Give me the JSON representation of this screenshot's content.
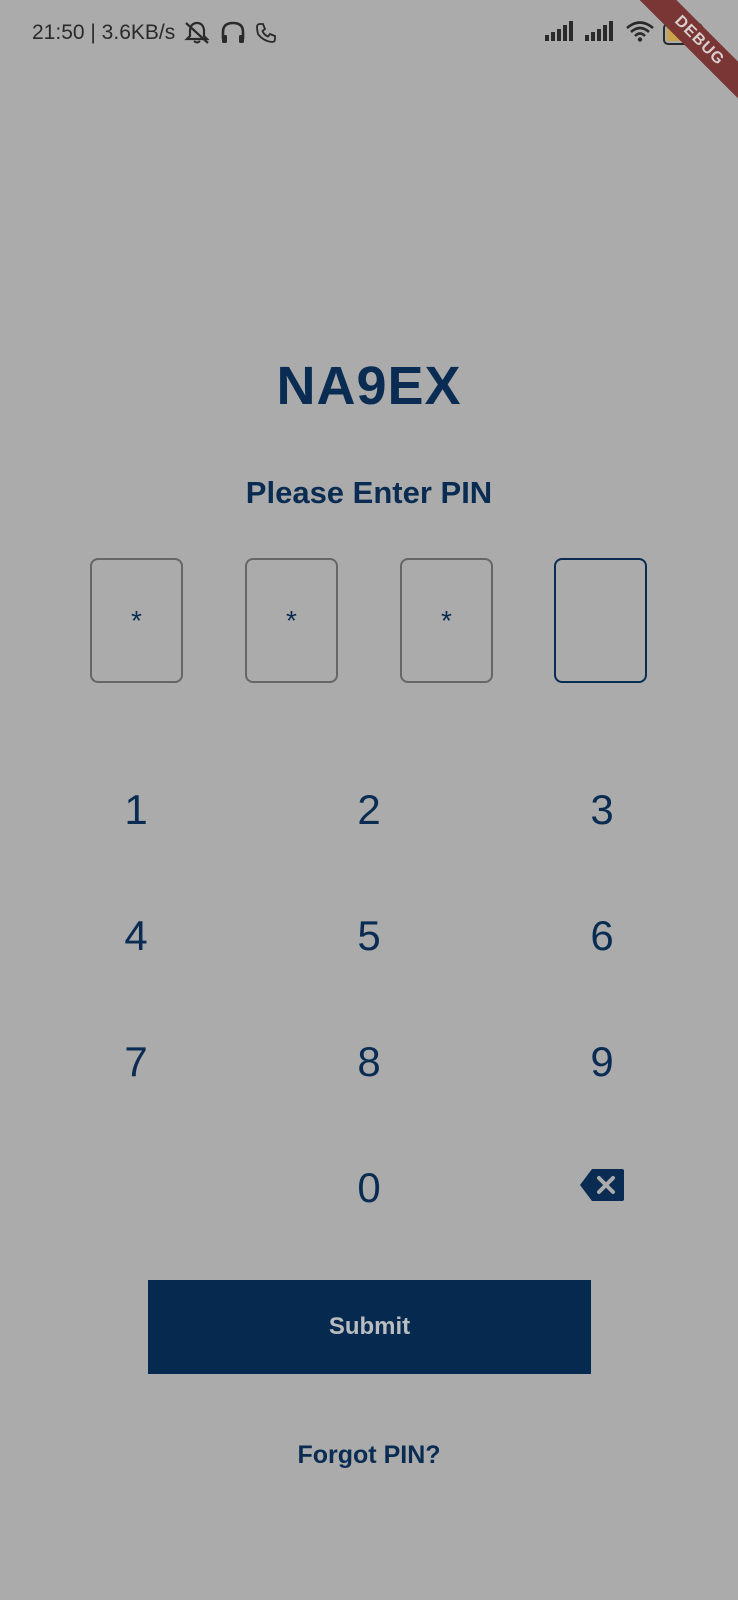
{
  "status_bar": {
    "time_speed": "21:50 | 3.6KB/s",
    "battery_level": "49",
    "battery_fraction": 0.49,
    "icons": [
      "bell-off-icon",
      "headphones-icon",
      "phone-icon",
      "signal-icon",
      "signal-icon",
      "wifi-icon",
      "battery-icon"
    ]
  },
  "debug_banner": "DEBUG",
  "app": {
    "brand": "NA9EX",
    "prompt": "Please Enter PIN"
  },
  "pin": {
    "boxes": [
      "*",
      "*",
      "*",
      ""
    ],
    "active_index": 3
  },
  "keypad": {
    "keys": [
      "1",
      "2",
      "3",
      "4",
      "5",
      "6",
      "7",
      "8",
      "9",
      "0"
    ],
    "backspace_icon": "backspace-icon"
  },
  "actions": {
    "submit_label": "Submit",
    "forgot_label": "Forgot PIN?"
  },
  "colors": {
    "background": "#ababab",
    "primary": "#0a2c52",
    "button": "#062a4f",
    "button_text": "#b9bcc0",
    "debug_ribbon": "#7a3535"
  }
}
